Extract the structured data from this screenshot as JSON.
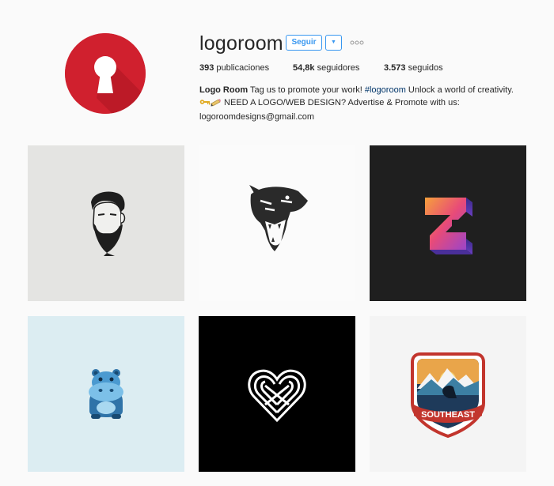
{
  "profile": {
    "username": "logoroom",
    "follow_label": "Seguir",
    "dropdown_glyph": "▼",
    "more_icon": "ellipsis-icon",
    "avatar_icon": "keyhole-icon",
    "avatar_color": "#d0202e"
  },
  "stats": {
    "posts_count": "393",
    "posts_label": " publicaciones",
    "followers_count": "54,8k",
    "followers_label": " seguidores",
    "following_count": "3.573",
    "following_label": " seguidos"
  },
  "bio": {
    "name": "Logo Room",
    "line1_text": " Tag us to promote your work! ",
    "hashtag": "#logoroom",
    "line1_tail": " Unlock a world of creativity.",
    "line2_text": " NEED A LOGO/WEB DESIGN? Advertise & Promote with us:",
    "email": "logoroomdesigns@gmail.com"
  },
  "posts": [
    {
      "icon": "bearded-man-icon",
      "background": "#e4e4e2"
    },
    {
      "icon": "roaring-panther-icon",
      "background": "#fbfbfb"
    },
    {
      "icon": "letter-z-gradient-icon",
      "background": "#1f1f1f"
    },
    {
      "icon": "hippo-icon",
      "background": "#dcedf2"
    },
    {
      "icon": "knot-heart-icon",
      "background": "#000000"
    },
    {
      "icon": "southeast-badge-icon",
      "background": "#f4f4f4",
      "badge_text": "SOUTHEAST"
    }
  ],
  "colors": {
    "accent": "#3897f0",
    "hashtag": "#003569",
    "text": "#262626"
  }
}
